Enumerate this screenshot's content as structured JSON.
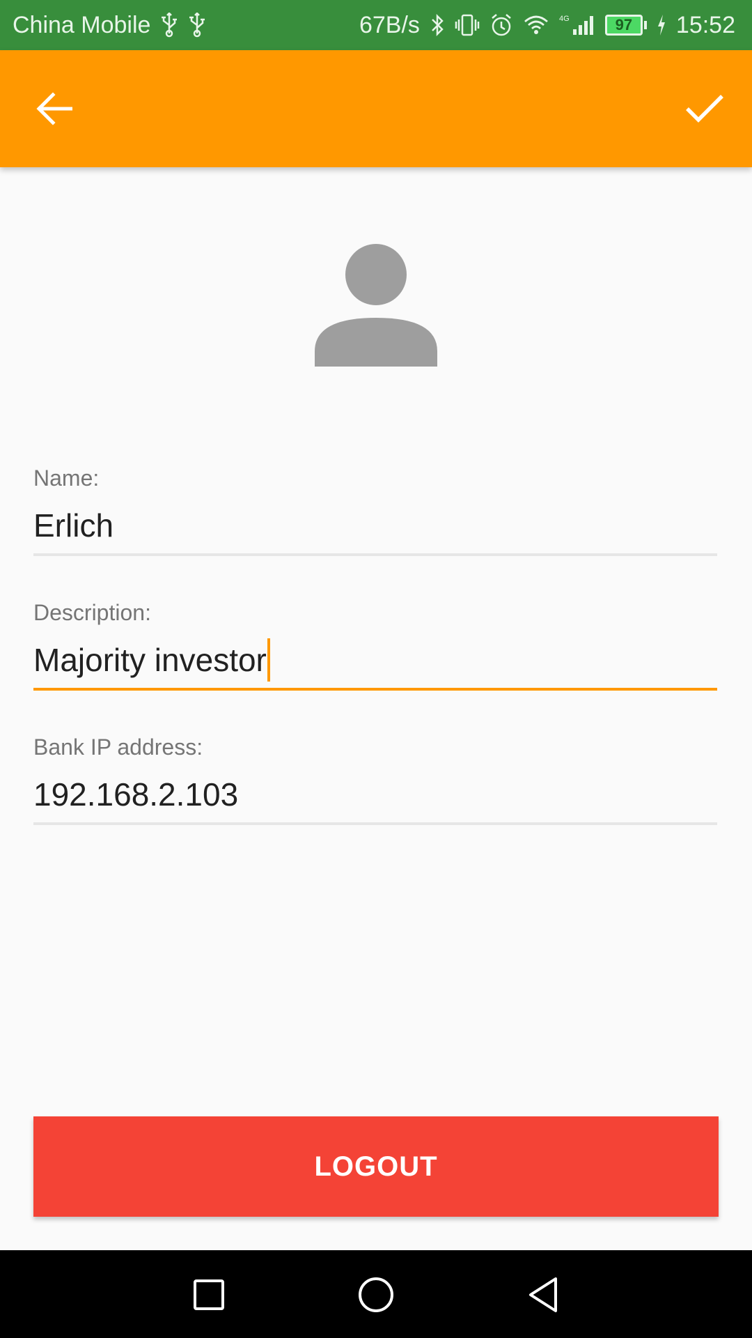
{
  "status_bar": {
    "carrier": "China Mobile",
    "net_speed": "67B/s",
    "network_type": "4G",
    "battery_level": "97",
    "time": "15:52",
    "icons": [
      "usb-icon",
      "usb-icon",
      "bluetooth-icon",
      "vibrate-icon",
      "alarm-icon",
      "wifi-icon",
      "signal-icon",
      "battery-icon",
      "charging-icon"
    ]
  },
  "app_bar": {
    "back_icon": "arrow-back-icon",
    "done_icon": "check-icon",
    "color": "#ff9800"
  },
  "profile": {
    "avatar_icon": "person-icon"
  },
  "form": {
    "name": {
      "label": "Name:",
      "value": "Erlich"
    },
    "description": {
      "label": "Description:",
      "value": "Majority investor"
    },
    "bank_ip": {
      "label": "Bank IP address:",
      "value": "192.168.2.103"
    }
  },
  "logout": {
    "label": "LOGOUT",
    "color": "#f44336"
  },
  "nav_bar": {
    "icons": [
      "recent-apps-icon",
      "home-icon",
      "back-icon"
    ]
  },
  "colors": {
    "status_bar": "#388e3c",
    "accent": "#ff9800"
  }
}
